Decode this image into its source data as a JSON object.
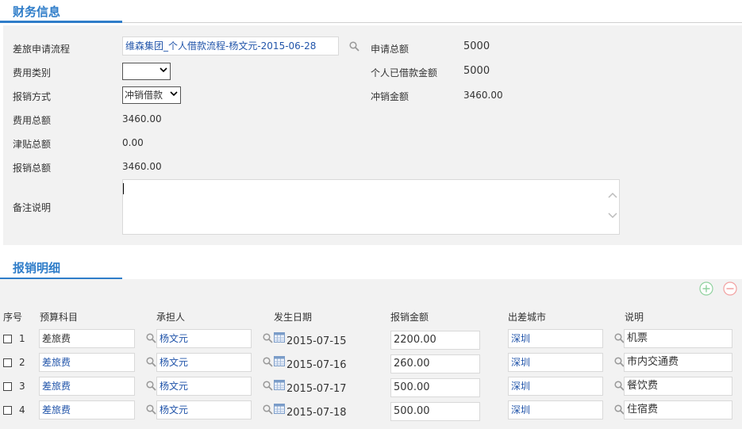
{
  "finance": {
    "title": "财务信息",
    "labels": {
      "travel_process": "差旅申请流程",
      "expense_type": "费用类别",
      "reimburse_method": "报销方式",
      "expense_total": "费用总额",
      "allowance_total": "津贴总额",
      "reimburse_total": "报销总额",
      "remarks": "备注说明",
      "apply_total": "申请总额",
      "borrowed_amount": "个人已借款金额",
      "offset_amount": "冲销金额"
    },
    "values": {
      "travel_process": "维森集团_个人借款流程-杨文元-2015-06-28",
      "expense_type": "",
      "reimburse_method": "冲销借款",
      "expense_total": "3460.00",
      "allowance_total": "0.00",
      "reimburse_total": "3460.00",
      "remarks": "",
      "apply_total": "5000",
      "borrowed_amount": "5000",
      "offset_amount": "3460.00"
    }
  },
  "details": {
    "title": "报销明细",
    "columns": [
      "序号",
      "预算科目",
      "承担人",
      "发生日期",
      "报销金额",
      "出差城市",
      "说明"
    ],
    "rows": [
      {
        "no": "1",
        "subject": "差旅费",
        "person": "杨文元",
        "date": "2015-07-15",
        "amount": "2200.00",
        "city": "深圳",
        "note": "机票"
      },
      {
        "no": "2",
        "subject": "差旅费",
        "person": "杨文元",
        "date": "2015-07-16",
        "amount": "260.00",
        "city": "深圳",
        "note": "市内交通费"
      },
      {
        "no": "3",
        "subject": "差旅费",
        "person": "杨文元",
        "date": "2015-07-17",
        "amount": "500.00",
        "city": "深圳",
        "note": "餐饮费"
      },
      {
        "no": "4",
        "subject": "差旅费",
        "person": "杨文元",
        "date": "2015-07-18",
        "amount": "500.00",
        "city": "深圳",
        "note": "住宿费"
      }
    ]
  },
  "colors": {
    "accent": "#2f7dc9",
    "add_green": "#8fd19e",
    "remove_red": "#f2a0a0",
    "link": "#2255aa"
  }
}
